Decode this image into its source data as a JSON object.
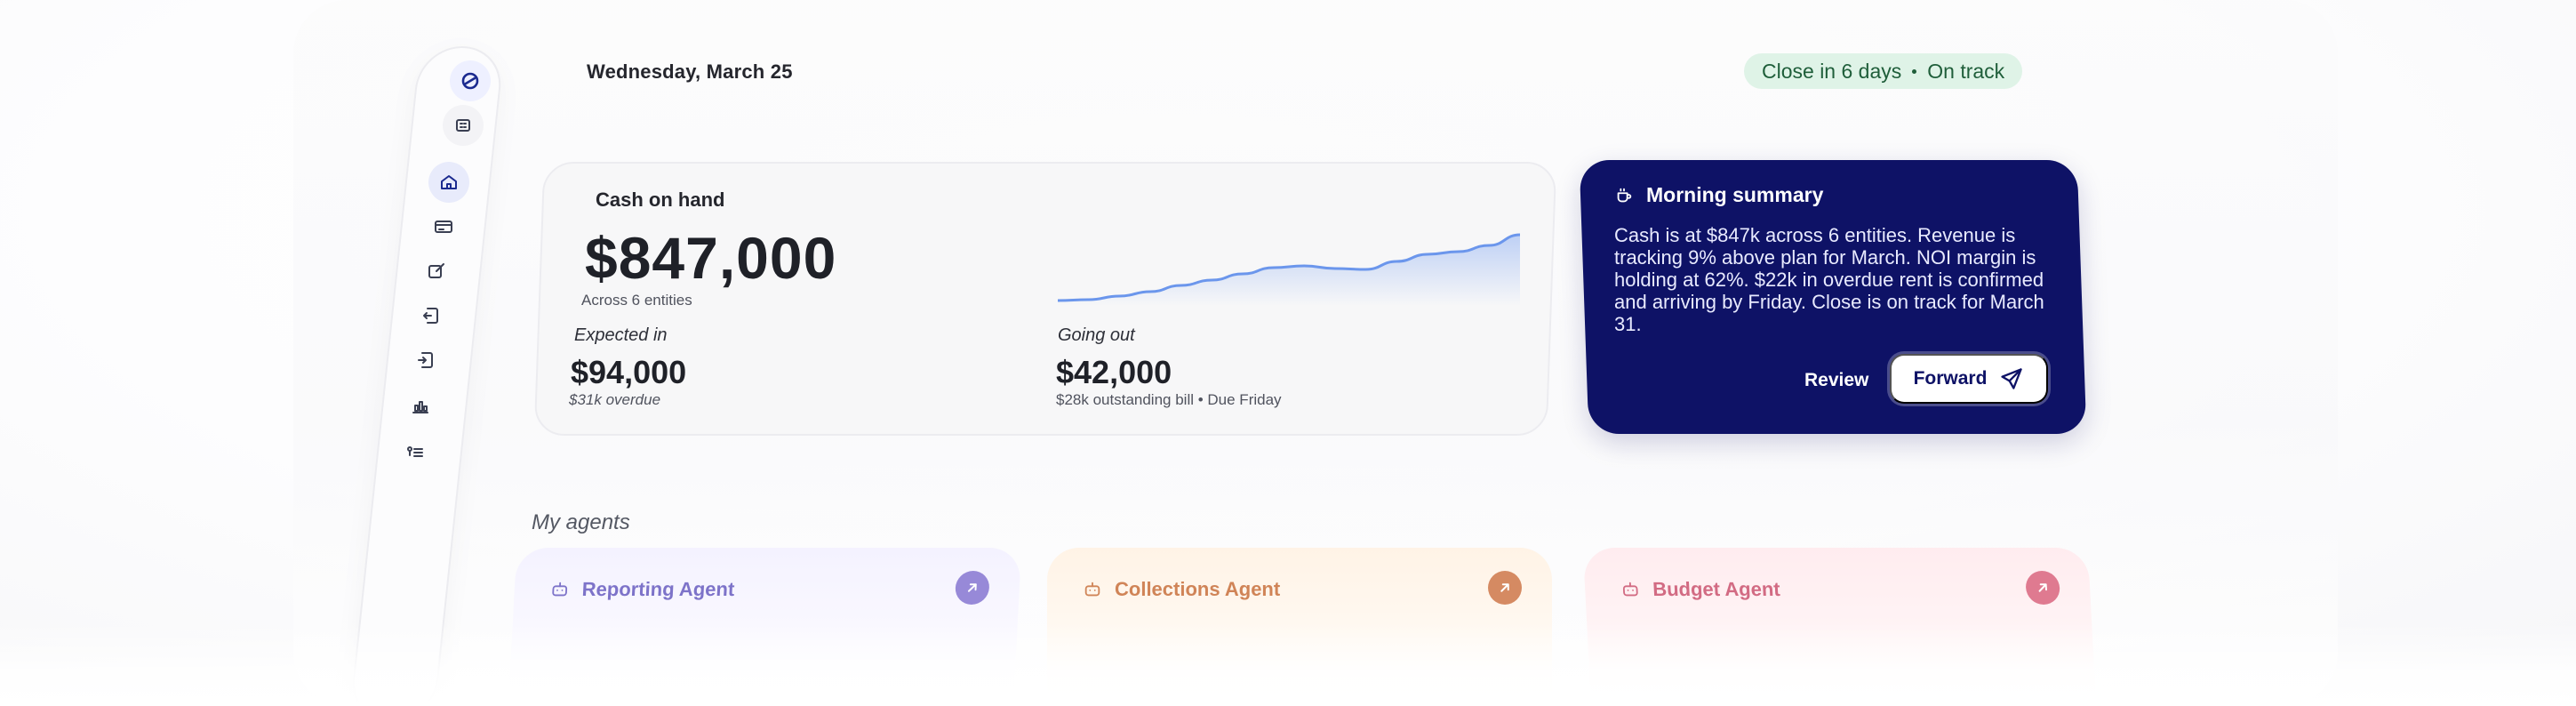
{
  "header": {
    "date": "Wednesday, March 25",
    "status": {
      "left": "Close in 6 days",
      "right": "On track"
    }
  },
  "sidebar": {
    "items": [
      {
        "icon": "logo-icon"
      },
      {
        "icon": "building-icon"
      },
      {
        "icon": "home-icon",
        "active": true
      },
      {
        "icon": "card-icon"
      },
      {
        "icon": "edit-icon"
      },
      {
        "icon": "invoice-in-icon"
      },
      {
        "icon": "invoice-out-icon"
      },
      {
        "icon": "chart-icon"
      },
      {
        "icon": "list-icon"
      }
    ]
  },
  "cash": {
    "title": "Cash on hand",
    "amount": "$847,000",
    "sub": "Across 6 entities",
    "expected": {
      "label": "Expected in",
      "value": "$94,000",
      "note": "$31k overdue"
    },
    "going_out": {
      "label": "Going out",
      "value": "$42,000",
      "note": "$28k outstanding bill • Due Friday"
    },
    "trend": [
      8,
      9,
      13,
      18,
      25,
      31,
      38,
      45,
      47,
      44,
      43,
      52,
      60,
      63,
      70,
      82
    ]
  },
  "summary": {
    "title": "Morning summary",
    "text": "Cash is at $847k across 6 entities. Revenue is tracking 9% above plan for March. NOI margin is holding at 62%. $22k in overdue rent is confirmed and arriving by Friday. Close is on track for March 31.",
    "review_label": "Review",
    "forward_label": "Forward"
  },
  "agents": {
    "title": "My agents",
    "items": [
      {
        "name": "Reporting Agent"
      },
      {
        "name": "Collections Agent"
      },
      {
        "name": "Budget Agent"
      }
    ]
  },
  "colors": {
    "navy": "#0e1266",
    "green_bg": "#dff3e7",
    "chart_line": "#6b96ec",
    "reporting": "#9789d8",
    "collections": "#d58a62",
    "budget": "#df7a90"
  }
}
